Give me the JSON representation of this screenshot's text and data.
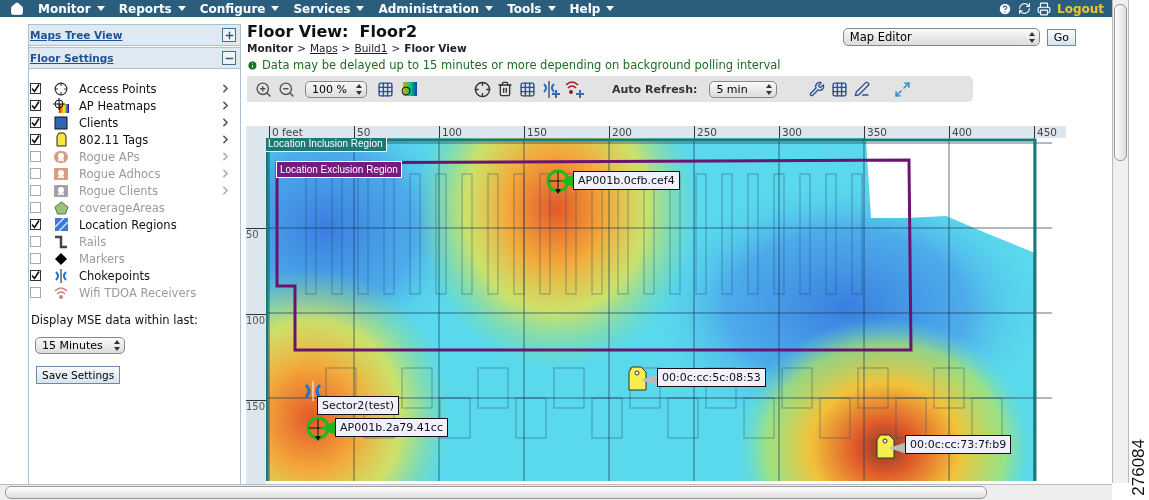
{
  "nav": {
    "items": [
      {
        "label": "Monitor"
      },
      {
        "label": "Reports"
      },
      {
        "label": "Configure"
      },
      {
        "label": "Services"
      },
      {
        "label": "Administration"
      },
      {
        "label": "Tools"
      },
      {
        "label": "Help"
      }
    ],
    "logout": "Logout"
  },
  "sidebar": {
    "maps_tree_view": "Maps Tree View",
    "floor_settings": "Floor Settings",
    "layers": [
      {
        "kind": "access-point",
        "label": "Access Points",
        "checked": true,
        "disabled": false,
        "has_arrow": true
      },
      {
        "kind": "heatmap",
        "label": "AP Heatmaps",
        "checked": true,
        "disabled": false,
        "has_arrow": true
      },
      {
        "kind": "client",
        "label": "Clients",
        "checked": true,
        "disabled": false,
        "has_arrow": true
      },
      {
        "kind": "tag",
        "label": "802.11 Tags",
        "checked": true,
        "disabled": false,
        "has_arrow": true
      },
      {
        "kind": "rogue-ap",
        "label": "Rogue APs",
        "checked": false,
        "disabled": true,
        "has_arrow": true
      },
      {
        "kind": "rogue-adhoc",
        "label": "Rogue Adhocs",
        "checked": false,
        "disabled": true,
        "has_arrow": true
      },
      {
        "kind": "rogue-client",
        "label": "Rogue Clients",
        "checked": false,
        "disabled": true,
        "has_arrow": true
      },
      {
        "kind": "coverage",
        "label": "coverageAreas",
        "checked": false,
        "disabled": true,
        "has_arrow": false
      },
      {
        "kind": "region",
        "label": "Location Regions",
        "checked": true,
        "disabled": false,
        "has_arrow": false
      },
      {
        "kind": "rail",
        "label": "Rails",
        "checked": false,
        "disabled": true,
        "has_arrow": false
      },
      {
        "kind": "marker",
        "label": "Markers",
        "checked": false,
        "disabled": true,
        "has_arrow": false
      },
      {
        "kind": "chokepoint",
        "label": "Chokepoints",
        "checked": true,
        "disabled": false,
        "has_arrow": false
      },
      {
        "kind": "tdoa",
        "label": "Wifi TDOA Receivers",
        "checked": false,
        "disabled": true,
        "has_arrow": false
      }
    ],
    "mse_label": "Display MSE data within last:",
    "mse_value": "15 Minutes",
    "save_button": "Save Settings"
  },
  "header": {
    "title": "Floor View:  Floor2",
    "breadcrumb_separator": ">",
    "breadcrumb": [
      {
        "label": "Monitor",
        "link": false
      },
      {
        "label": "Maps",
        "link": true
      },
      {
        "label": "Build1",
        "link": true
      },
      {
        "label": "Floor View",
        "link": false
      }
    ],
    "notice": "Data may be delayed up to 15 minutes or more depending on background polling interval",
    "action_select": "Map Editor",
    "go_button": "Go"
  },
  "toolbar": {
    "zoom": "100 %",
    "auto_refresh_label": "Auto Refresh:",
    "auto_refresh": "5 min"
  },
  "map": {
    "x_ruler": [
      "0 feet",
      "50",
      "100",
      "150",
      "200",
      "250",
      "300",
      "350",
      "400",
      "450"
    ],
    "y_ruler": [
      "50",
      "100",
      "150"
    ],
    "inclusion_label": "Location Inclusion Region",
    "exclusion_label": "Location Exclusion Region",
    "markers": [
      {
        "kind": "ap",
        "label": "AP001b.0cfb.cef4"
      },
      {
        "kind": "tag",
        "label": "00:0c:cc:5c:08:53"
      },
      {
        "kind": "chokepoint",
        "label": "Sector2(test)"
      },
      {
        "kind": "ap",
        "label": "AP001b.2a79.41cc"
      },
      {
        "kind": "tag",
        "label": "00:0c:cc:73:7f:b9"
      }
    ]
  },
  "figure_id": "276084"
}
